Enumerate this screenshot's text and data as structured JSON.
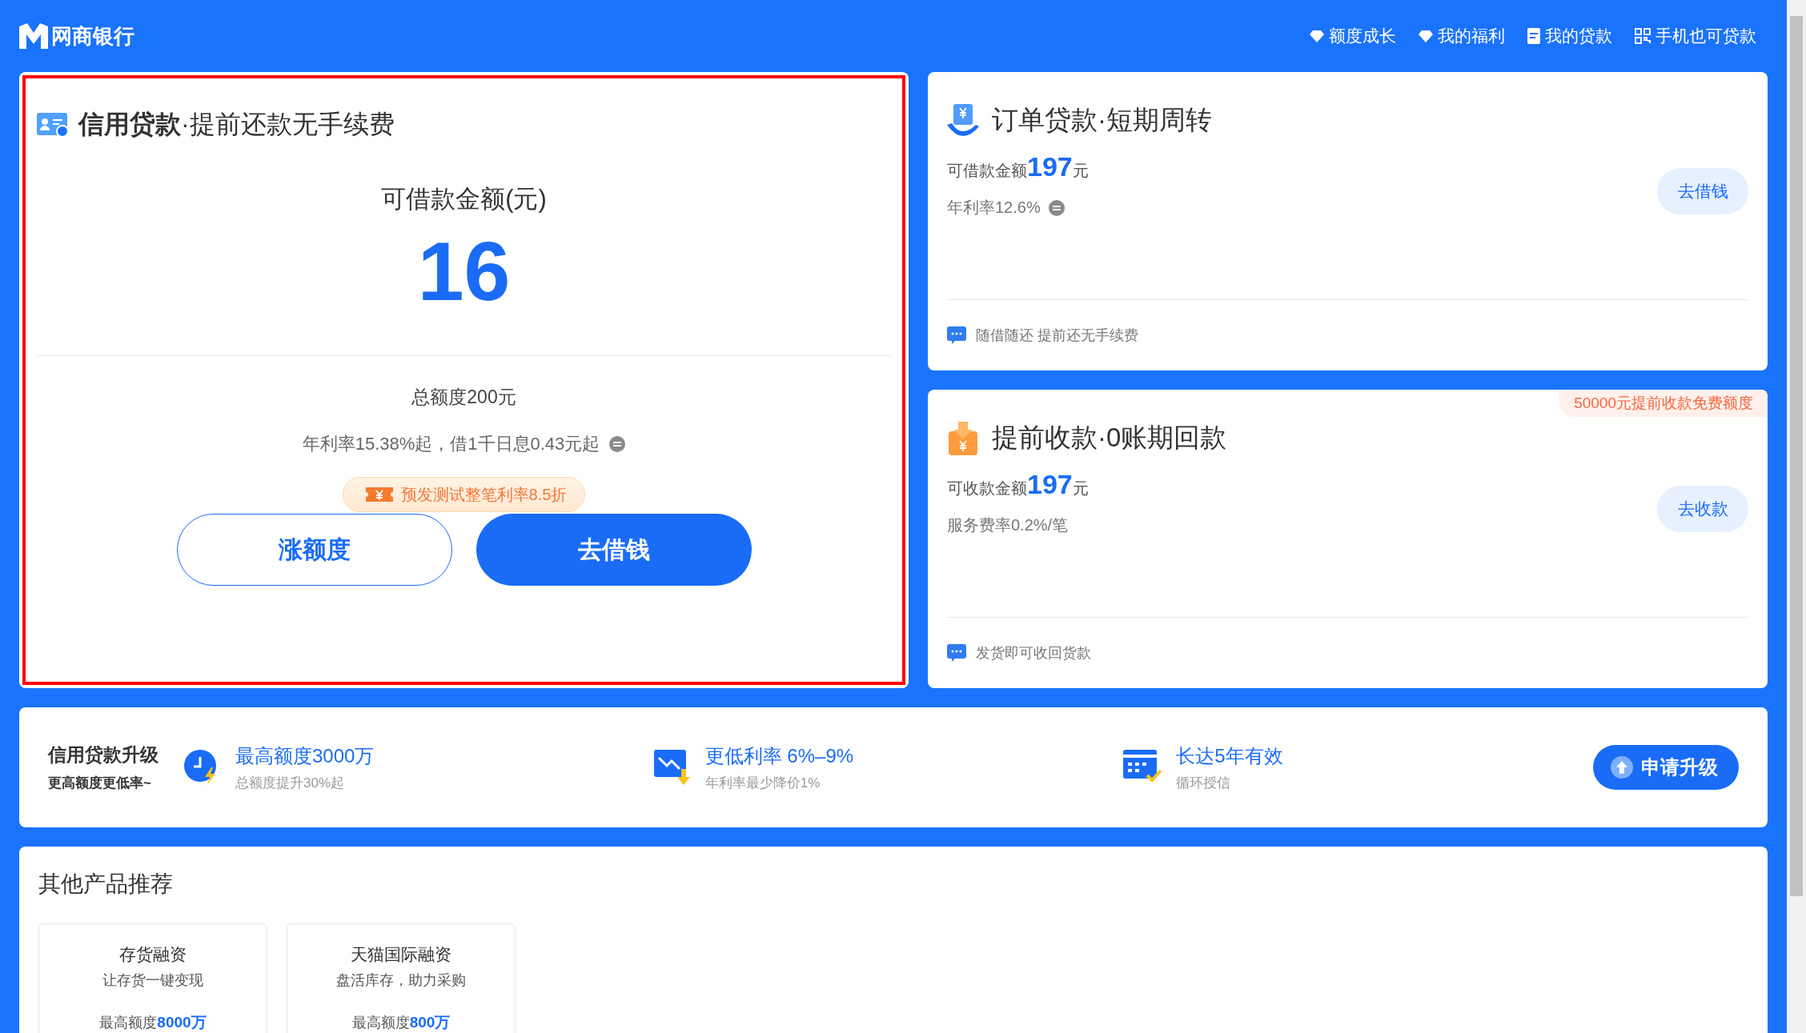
{
  "header": {
    "logo": "网商银行",
    "nav": [
      {
        "kind": "diamond",
        "label": "额度成长"
      },
      {
        "kind": "diamond",
        "label": "我的福利"
      },
      {
        "kind": "doc",
        "label": "我的贷款"
      },
      {
        "kind": "qr",
        "label": "手机也可贷款"
      }
    ]
  },
  "credit_loan": {
    "highlighted": true,
    "title": "**信用贷款**·提前还款无手续费",
    "amount_label": "可借款金额(元)",
    "amount": "16",
    "total": "总额度200元",
    "rate": "年利率15.38%起，借1千日息0.43元起",
    "promo": "预发测试整笔利率8.5折",
    "buttons": [
      {
        "kind": "outline",
        "label": "涨额度"
      },
      {
        "kind": "primary",
        "label": "去借钱"
      }
    ]
  },
  "products": [
    {
      "kind": "order",
      "title": "订单贷款·短期周转",
      "amount": "可借款金额**197**元",
      "rate": "年利率12.6%",
      "rate_info": true,
      "button": "去借钱",
      "note": "随借随还 提前还无手续费"
    },
    {
      "kind": "receive",
      "title": "提前收款·0账期回款",
      "badge": "50000元提前收款免费额度",
      "amount": "可收款金额**197**元",
      "rate": "服务费率0.2%/笔",
      "button": "去收款",
      "note": "发货即可收回货款"
    }
  ],
  "upgrade": {
    "title": "信用贷款升级",
    "subtitle": "更高额度更低率~",
    "features": [
      {
        "kind": "clock",
        "title": "最高额度3000万",
        "subtitle": "总额度提升30%起"
      },
      {
        "kind": "chart",
        "title": "更低利率 6%–9%",
        "subtitle": "年利率最少降价1%"
      },
      {
        "kind": "calendar",
        "title": "长达5年有效",
        "subtitle": "循环授信"
      }
    ],
    "button": "申请升级"
  },
  "other_products": {
    "title": "其他产品推荐",
    "items": [
      {
        "name": "存货融资",
        "desc": "让存货一键变现",
        "limit": "最高额度**8000万**"
      },
      {
        "name": "天猫国际融资",
        "desc": "盘活库存，助力采购",
        "limit": "最高额度**800万**"
      }
    ]
  }
}
